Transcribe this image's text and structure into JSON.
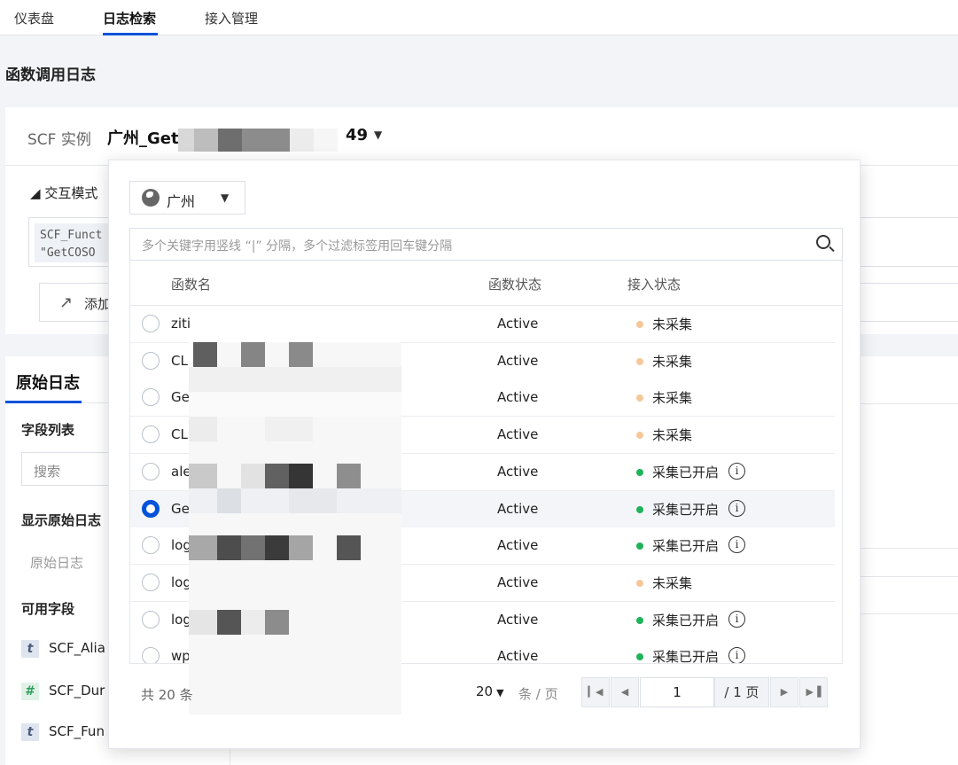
{
  "nav": {
    "tabs": [
      "仪表盘",
      "日志检索",
      "接入管理"
    ],
    "active_tab": "日志检索"
  },
  "page_title": "函数调用日志",
  "instance": {
    "label": "SCF 实例",
    "value_prefix": "广州_Get",
    "value_suffix": "49"
  },
  "query": {
    "mode_label": "交互模式",
    "chip_line1": "SCF_Funct",
    "chip_line2": "\"GetCOSO",
    "add_label": "添加"
  },
  "raw_log": {
    "tab": "原始日志",
    "field_list_title": "字段列表",
    "search_placeholder": "搜索",
    "show_raw_title": "显示原始日志",
    "raw_log_item": "原始日志",
    "available_fields_title": "可用字段",
    "fields": [
      {
        "badge": "t",
        "name": "SCF_Alia"
      },
      {
        "badge": "#",
        "name": "SCF_Dur"
      },
      {
        "badge": "t",
        "name": "SCF_Fun"
      }
    ]
  },
  "dropdown": {
    "region": "广州",
    "filter_placeholder": "多个关键字用竖线 “|” 分隔，多个过滤标签用回车键分隔",
    "columns": {
      "name": "函数名",
      "status": "函数状态",
      "ingest": "接入状态"
    },
    "rows": [
      {
        "name": "ziti",
        "status": "Active",
        "ingest": "未采集",
        "on": false,
        "selected": false
      },
      {
        "name": "CL",
        "status": "Active",
        "ingest": "未采集",
        "on": false,
        "selected": false
      },
      {
        "name": "Ge",
        "status": "Active",
        "ingest": "未采集",
        "on": false,
        "selected": false
      },
      {
        "name": "CL",
        "status": "Active",
        "ingest": "未采集",
        "on": false,
        "selected": false
      },
      {
        "name": "ale",
        "status": "Active",
        "ingest": "采集已开启",
        "on": true,
        "selected": false
      },
      {
        "name": "Ge",
        "status": "Active",
        "ingest": "采集已开启",
        "on": true,
        "selected": true
      },
      {
        "name": "log",
        "status": "Active",
        "ingest": "采集已开启",
        "on": true,
        "selected": false
      },
      {
        "name": "log",
        "status": "Active",
        "ingest": "未采集",
        "on": false,
        "selected": false
      },
      {
        "name": "log",
        "status": "Active",
        "ingest": "采集已开启",
        "on": true,
        "selected": false
      },
      {
        "name": "wp",
        "status": "Active",
        "ingest": "采集已开启",
        "on": true,
        "selected": false
      }
    ],
    "footer": {
      "total": "共 20 条",
      "page_size": "20",
      "page_size_unit": "条 / 页",
      "current_page": "1",
      "total_pages": "/ 1 页"
    }
  },
  "colors": {
    "accent": "#0052d9",
    "status_on": "#1fb35a",
    "status_off": "#f5c89a"
  }
}
